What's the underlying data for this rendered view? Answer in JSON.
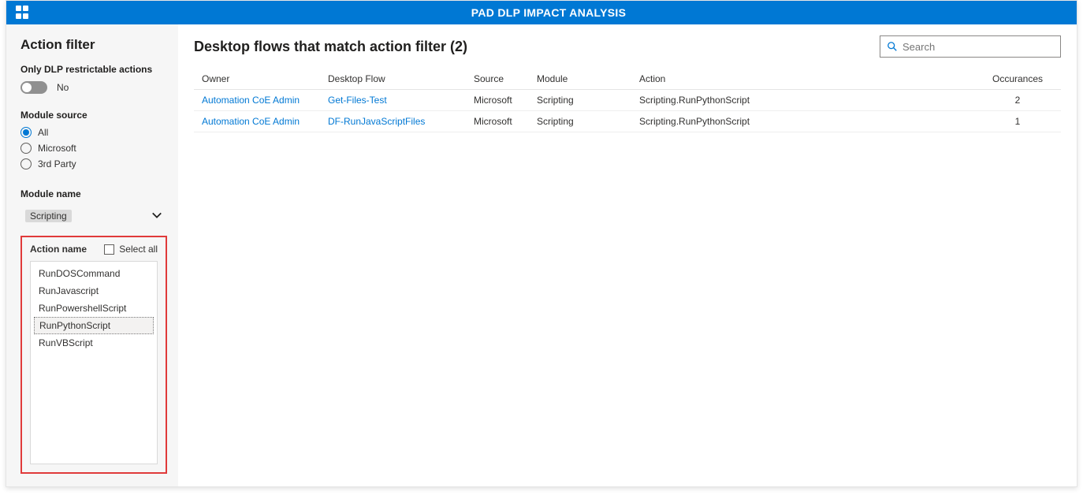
{
  "colors": {
    "accent": "#0078d4",
    "highlight": "#e03a3a"
  },
  "titlebar": {
    "title": "PAD DLP IMPACT ANALYSIS"
  },
  "sidebar": {
    "heading": "Action filter",
    "dlp_label": "Only DLP restrictable actions",
    "dlp_value": "No",
    "module_source_label": "Module source",
    "module_source_options": [
      {
        "label": "All",
        "selected": true
      },
      {
        "label": "Microsoft",
        "selected": false
      },
      {
        "label": "3rd Party",
        "selected": false
      }
    ],
    "module_name_label": "Module name",
    "module_name_value": "Scripting",
    "action_name_label": "Action name",
    "select_all_label": "Select all",
    "action_items": [
      {
        "label": "RunDOSCommand",
        "selected": false
      },
      {
        "label": "RunJavascript",
        "selected": false
      },
      {
        "label": "RunPowershellScript",
        "selected": false
      },
      {
        "label": "RunPythonScript",
        "selected": true
      },
      {
        "label": "RunVBScript",
        "selected": false
      }
    ]
  },
  "main": {
    "title": "Desktop flows that match action filter (2)",
    "search_placeholder": "Search",
    "columns": {
      "owner": "Owner",
      "flow": "Desktop Flow",
      "source": "Source",
      "module": "Module",
      "action": "Action",
      "occurances": "Occurances"
    },
    "rows": [
      {
        "owner": "Automation CoE Admin",
        "flow": "Get-Files-Test",
        "source": "Microsoft",
        "module": "Scripting",
        "action": "Scripting.RunPythonScript",
        "occurances": "2"
      },
      {
        "owner": "Automation CoE Admin",
        "flow": "DF-RunJavaScriptFiles",
        "source": "Microsoft",
        "module": "Scripting",
        "action": "Scripting.RunPythonScript",
        "occurances": "1"
      }
    ]
  }
}
